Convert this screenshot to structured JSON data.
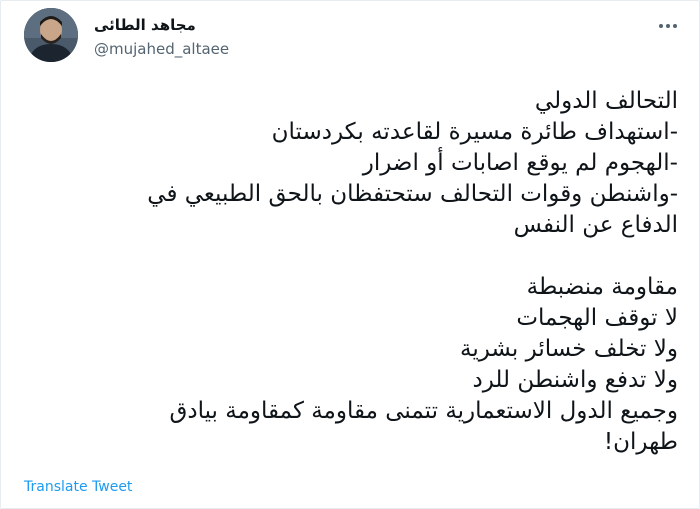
{
  "user": {
    "display_name": "مجاهد الطائى",
    "handle": "@mujahed_altaee"
  },
  "tweet": {
    "text": "التحالف الدولي\n-استهداف طائرة مسيرة لقاعدته بكردستان\n-الهجوم لم يوقع اصابات أو اضرار\n-واشنطن وقوات التحالف ستحتفظان بالحق الطبيعي في\nالدفاع عن النفس\n\nمقاومة منضبطة\nلا توقف الهجمات\nولا تخلف خسائر بشرية\nولا تدفع واشنطن للرد\nوجميع الدول الاستعمارية تتمنى مقاومة كمقاومة بيادق\nطهران!"
  },
  "actions": {
    "translate_label": "Translate Tweet",
    "more_icon": "more-horizontal-icon"
  },
  "colors": {
    "link": "#1d9bf0",
    "secondary_text": "#536471"
  }
}
